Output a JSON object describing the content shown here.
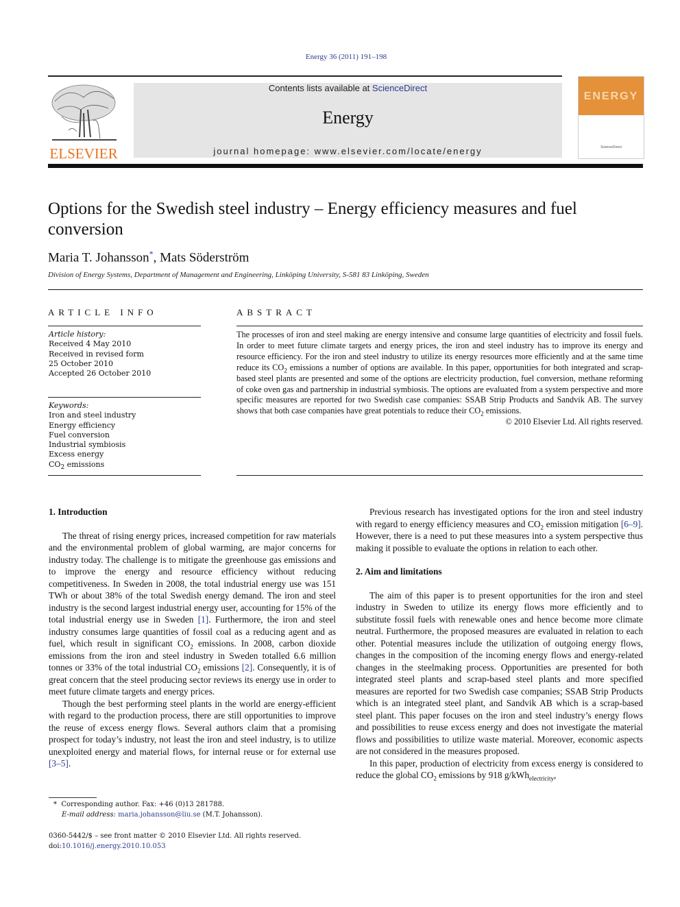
{
  "header": {
    "citation": "Energy 36 (2011) 191–198",
    "contents_prefix": "Contents lists available at ",
    "contents_link": "ScienceDirect",
    "journal_name": "Energy",
    "homepage": "journal homepage: www.elsevier.com/locate/energy",
    "publisher_logo_text": "ELSEVIER",
    "cover_title": "ENERGY"
  },
  "article": {
    "title": "Options for the Swedish steel industry – Energy efficiency measures and fuel conversion",
    "authors": [
      {
        "name": "Maria T. Johansson",
        "mark": "*"
      },
      {
        "name": "Mats Söderström",
        "mark": ""
      }
    ],
    "author_separator": ", ",
    "affiliation": "Division of Energy Systems, Department of Management and Engineering, Linköping University, S-581 83 Linköping, Sweden"
  },
  "article_info": {
    "heading": "ARTICLE INFO",
    "history_label": "Article history:",
    "history": [
      "Received 4 May 2010",
      "Received in revised form",
      "25 October 2010",
      "Accepted 26 October 2010"
    ],
    "keywords_label": "Keywords:",
    "keywords": [
      "Iron and steel industry",
      "Energy efficiency",
      "Fuel conversion",
      "Industrial symbiosis",
      "Excess energy",
      "CO2 emissions"
    ]
  },
  "abstract": {
    "heading": "ABSTRACT",
    "text_1": "The processes of iron and steel making are energy intensive and consume large quantities of electricity and fossil fuels. In order to meet future climate targets and energy prices, the iron and steel industry has to improve its energy and resource efficiency. For the iron and steel industry to utilize its energy resources more efficiently and at the same time reduce its CO",
    "text_2": " emissions a number of options are available. In this paper, opportunities for both integrated and scrap-based steel plants are presented and some of the options are electricity production, fuel conversion, methane reforming of coke oven gas and partnership in industrial symbiosis. The options are evaluated from a system perspective and more specific measures are reported for two Swedish case companies: SSAB Strip Products and Sandvik AB. The survey shows that both case companies have great potentials to reduce their CO",
    "text_3": " emissions.",
    "copyright": "© 2010 Elsevier Ltd. All rights reserved."
  },
  "body": {
    "sec1_heading": "1.  Introduction",
    "sec1_p1_a": "The threat of rising energy prices, increased competition for raw materials and the environmental problem of global warming, are major concerns for industry today. The challenge is to mitigate the greenhouse gas emissions and to improve the energy and resource efficiency without reducing competitiveness. In Sweden in 2008, the total industrial energy use was 151 TWh or about 38% of the total Swedish energy demand. The iron and steel industry is the second largest industrial energy user, accounting for 15% of the total industrial energy use in Sweden ",
    "ref1": "[1]",
    "sec1_p1_b": ". Furthermore, the iron and steel industry consumes large quantities of fossil coal as a reducing agent and as fuel, which result in significant CO",
    "sec1_p1_c": " emissions. In 2008, carbon dioxide emissions from the iron and steel industry in Sweden totalled 6.6 million tonnes or 33% of the total industrial CO",
    "sec1_p1_d": " emissions ",
    "ref2": "[2]",
    "sec1_p1_e": ". Consequently, it is of great concern that the steel producing sector reviews its energy use in order to meet future climate targets and energy prices.",
    "sec1_p2_a": "Though the best performing steel plants in the world are energy-efficient with regard to the production process, there are still opportunities to improve the reuse of excess energy flows. Several authors claim that a promising prospect for today’s industry, not least the iron and steel industry, is to utilize unexploited energy and material flows, for internal reuse or for external use ",
    "ref3": "[3–5]",
    "sec1_p2_b": ".",
    "sec1_p3_a": "Previous research has investigated options for the iron and steel industry with regard to energy efficiency measures and CO",
    "sec1_p3_b": " emission mitigation ",
    "ref4": "[6–9]",
    "sec1_p3_c": ". However, there is a need to put these measures into a system perspective thus making it possible to evaluate the options in relation to each other.",
    "sec2_heading": "2.  Aim and limitations",
    "sec2_p1": "The aim of this paper is to present opportunities for the iron and steel industry in Sweden to utilize its energy flows more efficiently and to substitute fossil fuels with renewable ones and hence become more climate neutral. Furthermore, the proposed measures are evaluated in relation to each other. Potential measures include the utilization of outgoing energy flows, changes in the composition of the incoming energy flows and energy-related changes in the steelmaking process. Opportunities are presented for both integrated steel plants and scrap-based steel plants and more specified measures are reported for two Swedish case companies; SSAB Strip Products which is an integrated steel plant, and Sandvik AB which is a scrap-based steel plant. This paper focuses on the iron and steel industry’s energy flows and possibilities to reuse excess energy and does not investigate the material flows and possibilities to utilize waste material. Moreover, economic aspects are not considered in the measures proposed.",
    "sec2_p2_a": "In this paper, production of electricity from excess energy is considered to reduce the global CO",
    "sec2_p2_b": " emissions by 918 g/kWh",
    "sec2_p2_sub": "electricity",
    "sec2_p2_c": ",",
    "co2_sub": "2"
  },
  "footnotes": {
    "mark": "*",
    "corresponding": "Corresponding author. Fax: +46 (0)13 281788.",
    "email_label": "E-mail address: ",
    "email": "maria.johansson@liu.se",
    "email_suffix": " (M.T. Johansson).",
    "issn": "0360-5442/$ – see front matter © 2010 Elsevier Ltd. All rights reserved.",
    "doi_label": "doi:",
    "doi": "10.1016/j.energy.2010.10.053"
  },
  "colors": {
    "link": "#2a3c8e",
    "elsevier_orange": "#e9711c",
    "banner_gray": "#e5e5e5",
    "cover_orange": "#e4913a"
  }
}
